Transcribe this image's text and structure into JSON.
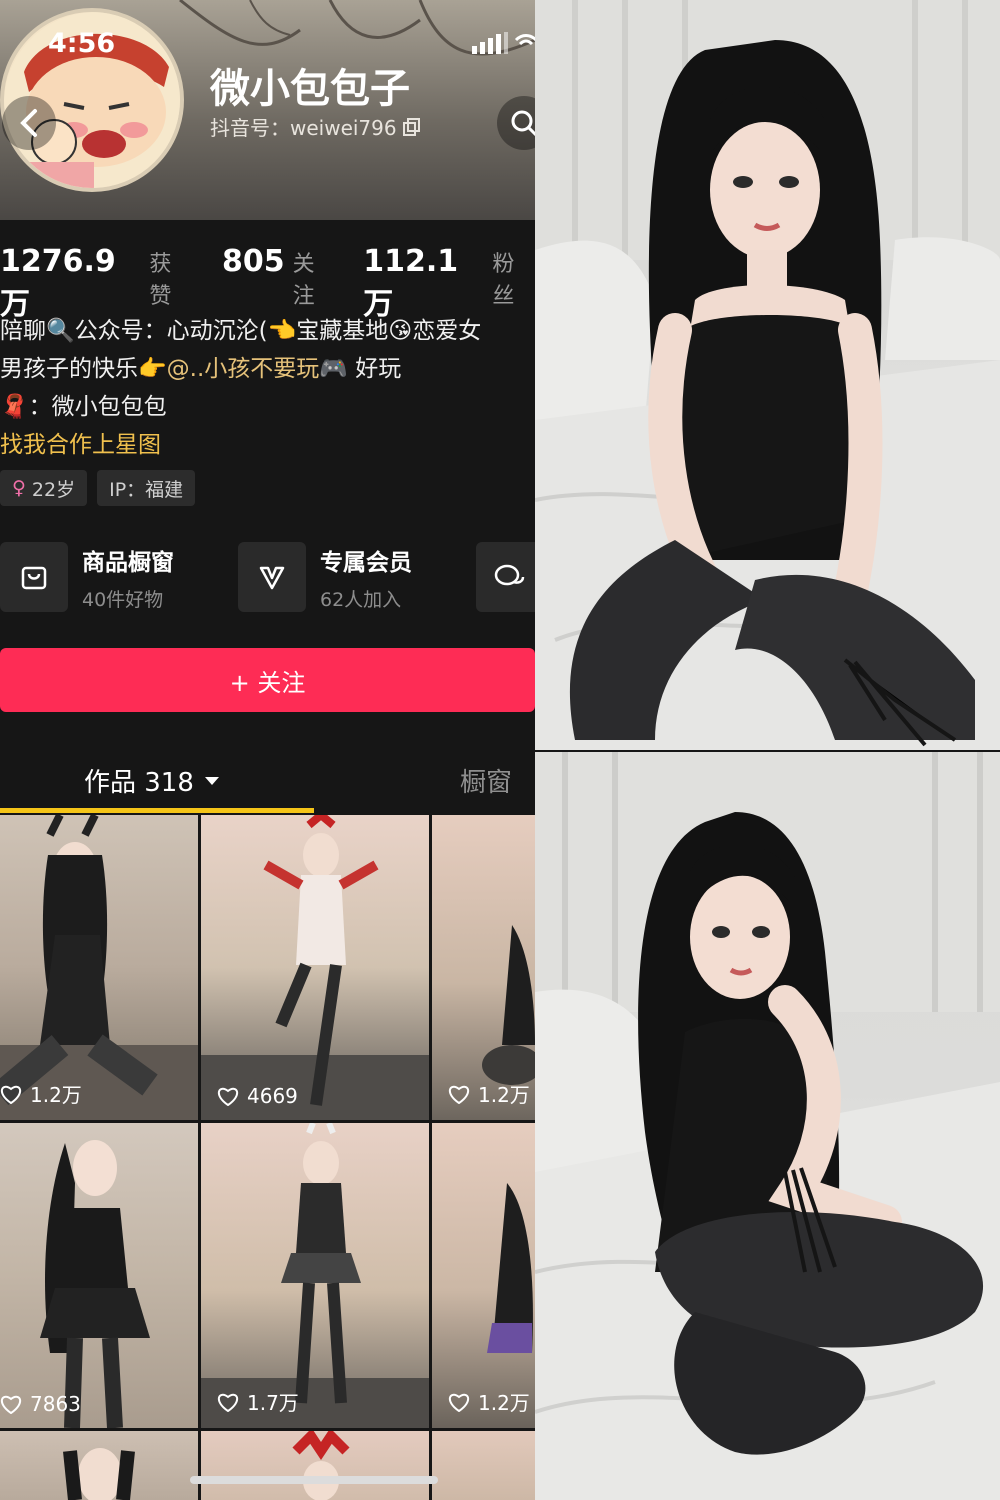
{
  "status_bar": {
    "time": "4:56"
  },
  "profile": {
    "name": "微小包包子",
    "account_id": "抖音号：weiwei796",
    "stats": [
      {
        "value": "1276.9万",
        "label": "获赞"
      },
      {
        "value": "805",
        "label": "关注"
      },
      {
        "value": "112.1万",
        "label": "粉丝"
      }
    ],
    "bio": {
      "line1": "陪聊🔍公众号：心动沉沦(👈宝藏基地😘恋爱女",
      "line2_prefix": "男孩子的快乐👉",
      "line2_link": "@..小孩不要玩",
      "line2_suffix": "🎮 好玩",
      "line3": "🧣：微小包包包",
      "line4": "找我合作上星图"
    },
    "tags": {
      "age": "22岁",
      "ip": "IP：福建"
    }
  },
  "features": [
    {
      "title": "商品橱窗",
      "sub": "40件好物"
    },
    {
      "title": "专属会员",
      "sub": "62人加入"
    }
  ],
  "follow_label": "+ 关注",
  "tabs": {
    "works": "作品 318",
    "window": "橱窗"
  },
  "videos": [
    {
      "likes": "1.2万"
    },
    {
      "likes": "4669"
    },
    {
      "likes": "1.2万"
    },
    {
      "likes": "7863"
    },
    {
      "likes": "1.7万"
    },
    {
      "likes": "1.2万"
    }
  ]
}
